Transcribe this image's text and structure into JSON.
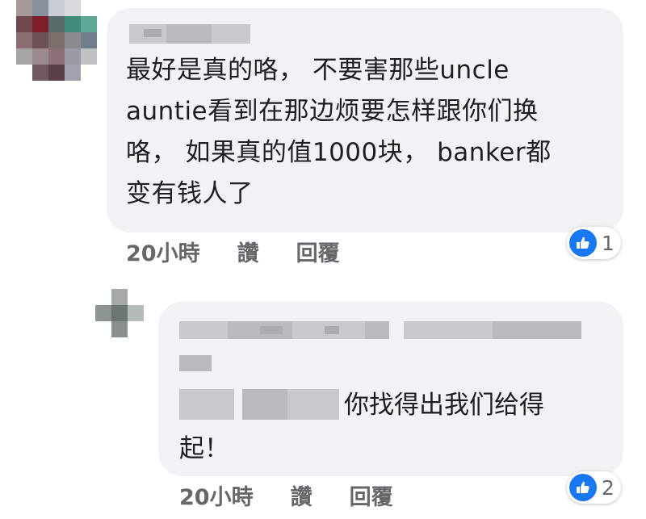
{
  "comments": [
    {
      "lines": [
        "最好是真的咯， 不要害那些uncle",
        "auntie看到在那边烦要怎样跟你们换",
        "咯， 如果真的值1000块， banker都",
        "变有钱人了"
      ],
      "time": "20小時",
      "like_label": "讚",
      "reply_label": "回覆",
      "reaction_count": "1"
    },
    {
      "text_line1": "你找得出我们给得",
      "text_line2": "起！",
      "time": "20小時",
      "like_label": "讚",
      "reply_label": "回覆",
      "reaction_count": "2"
    }
  ],
  "colors": {
    "bubble": "#f0f2f5",
    "meta_text": "#65676b",
    "like_blue": "#1877f2"
  },
  "icons": {
    "reaction": "thumbs-up-icon"
  }
}
